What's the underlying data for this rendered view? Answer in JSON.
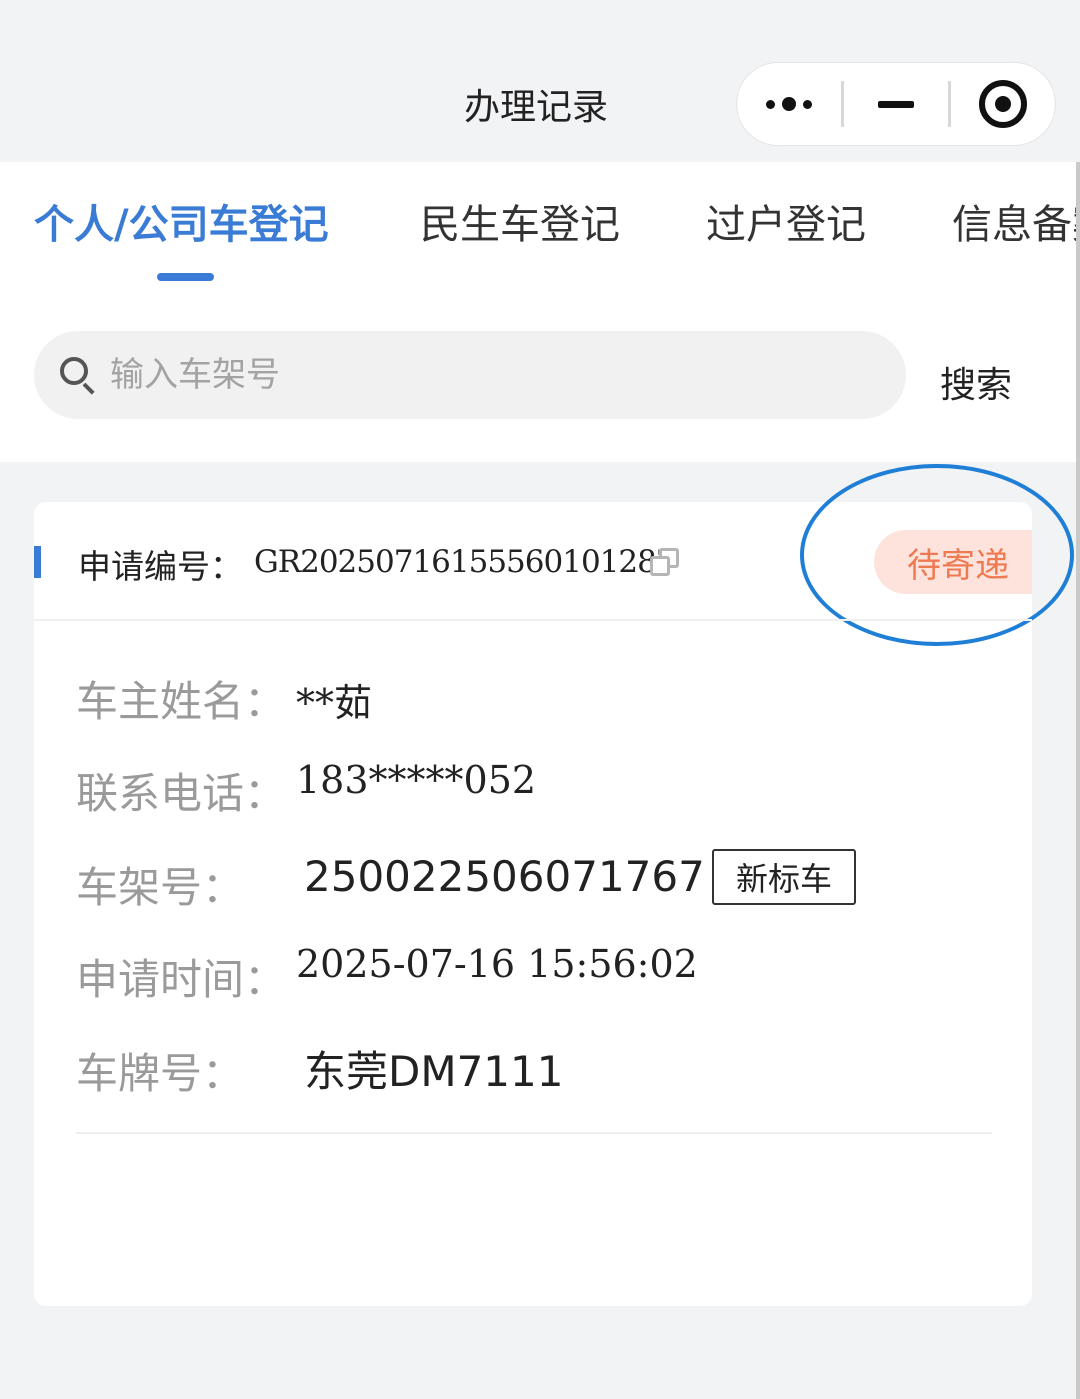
{
  "header": {
    "title": "办理记录"
  },
  "capsule": {
    "more_icon": "more-dots-icon",
    "minimize_icon": "minimize-icon",
    "close_icon": "target-circle-icon"
  },
  "tabs": [
    {
      "label": "个人/公司车登记",
      "active": true
    },
    {
      "label": "民生车登记",
      "active": false
    },
    {
      "label": "过户登记",
      "active": false
    },
    {
      "label": "信息备案",
      "active": false
    }
  ],
  "search": {
    "placeholder": "输入车架号",
    "value": "",
    "button_label": "搜索"
  },
  "record": {
    "app_label": "申请编号：",
    "app_no": "GR20250716155560101287",
    "status": "待寄递",
    "rows": {
      "owner_label": "车主姓名：",
      "owner_value": "**茹",
      "phone_label": "联系电话：",
      "phone_value": "183*****052",
      "vin_label": "车架号：",
      "vin_value": "250022506071767",
      "vin_tag": "新标车",
      "time_label": "申请时间：",
      "time_value": "2025-07-16 15:56:02",
      "plate_label": "车牌号：",
      "plate_value": "东莞DM7111"
    }
  },
  "colors": {
    "accent": "#3a7bd5",
    "status_text": "#ee7a52",
    "status_bg": "#fde3dc",
    "highlight": "#1f7ed6"
  }
}
